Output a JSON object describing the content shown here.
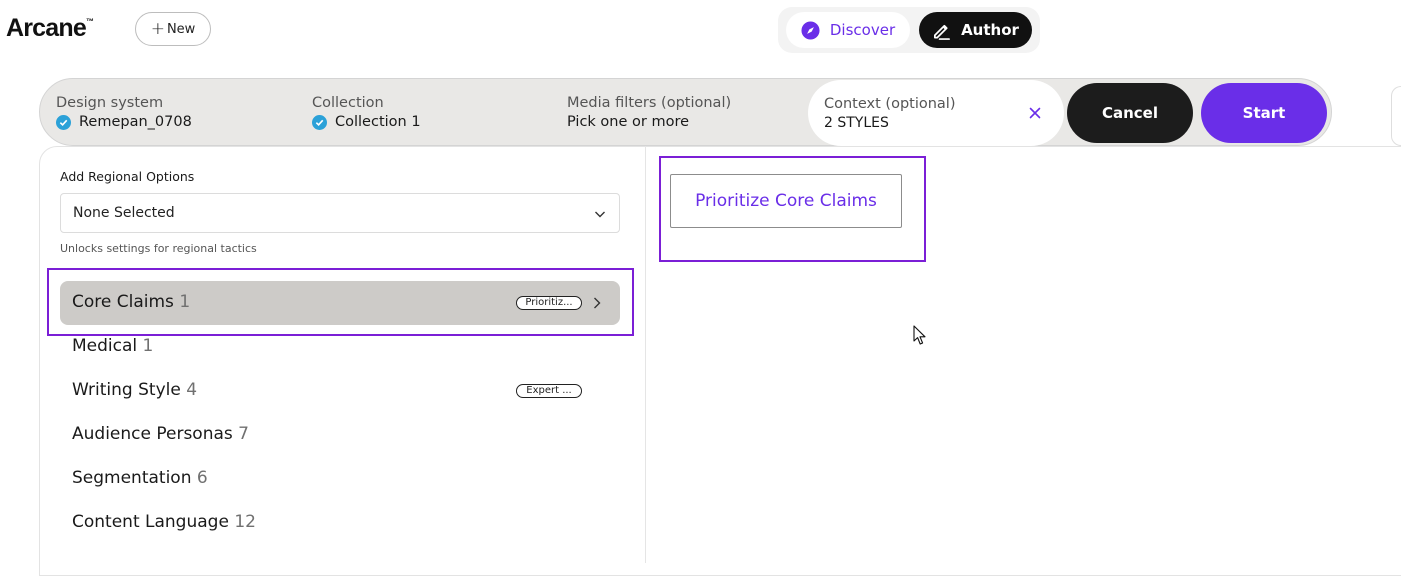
{
  "app": {
    "name": "Arcane",
    "trademark": "™"
  },
  "header": {
    "new_button": "New"
  },
  "mode_toggle": {
    "discover": "Discover",
    "author": "Author",
    "active": "Author"
  },
  "search_bar": {
    "design_system": {
      "label": "Design system",
      "value": "Remepan_0708"
    },
    "collection": {
      "label": "Collection",
      "value": "Collection 1"
    },
    "media_filters": {
      "label": "Media filters (optional)",
      "value": "Pick one or more"
    },
    "context": {
      "label": "Context (optional)",
      "value": "2 STYLES"
    },
    "cancel": "Cancel",
    "start": "Start"
  },
  "regional": {
    "label": "Add Regional Options",
    "selected": "None Selected",
    "hint": "Unlocks settings for regional tactics"
  },
  "categories": [
    {
      "name": "Core Claims",
      "count": "1",
      "pill": "Prioritiz...",
      "selected": true
    },
    {
      "name": "Medical",
      "count": "1"
    },
    {
      "name": "Writing Style",
      "count": "4",
      "pill": "Expert ..."
    },
    {
      "name": "Audience Personas",
      "count": "7"
    },
    {
      "name": "Segmentation",
      "count": "6"
    },
    {
      "name": "Content Language",
      "count": "12"
    }
  ],
  "options": {
    "prioritize_core_claims": "Prioritize Core Claims"
  },
  "colors": {
    "accent": "#6a2ee8",
    "check": "#2ba1d8",
    "highlight": "#7b1fd6",
    "dark": "#1c1c1c"
  },
  "icons": [
    "plus-icon",
    "compass-icon",
    "pencil-icon",
    "check-circle-icon",
    "close-icon",
    "chevron-down-icon",
    "chevron-right-icon",
    "mouse-cursor"
  ]
}
